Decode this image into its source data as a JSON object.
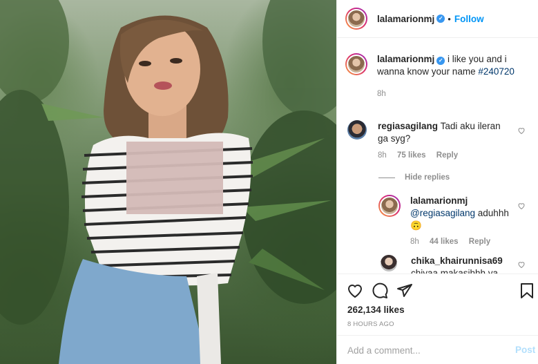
{
  "post": {
    "author": "lalamarionmj",
    "verified_icon": "verified-badge-icon",
    "follow_label": "Follow",
    "dot": "•"
  },
  "caption": {
    "username": "lalamarionmj",
    "text": "i like you and i wanna know your name",
    "hashtag": "#240720",
    "time": "8h"
  },
  "comments": [
    {
      "username": "regiasagilang",
      "text": "Tadi aku ileran ga syg?",
      "time": "8h",
      "likes": "75 likes",
      "reply_label": "Reply"
    }
  ],
  "hide_replies_label": "Hide replies",
  "replies": [
    {
      "username": "lalamarionmj",
      "mention": "@regiasagilang",
      "text": "aduhhh",
      "emoji": "🙃",
      "time": "8h",
      "likes": "44 likes",
      "reply_label": "Reply"
    },
    {
      "username": "chika_khairunnisa69",
      "text": "chiyaa makasihhh ya"
    }
  ],
  "likes_count": "262,134 likes",
  "timestamp": "8 HOURS AGO",
  "add_comment": {
    "placeholder": "Add a comment...",
    "post_label": "Post"
  },
  "colors": {
    "link": "#0095f6",
    "verified": "#3897f0",
    "muted": "#8e8e8e",
    "post_disabled": "#b2dffc"
  }
}
